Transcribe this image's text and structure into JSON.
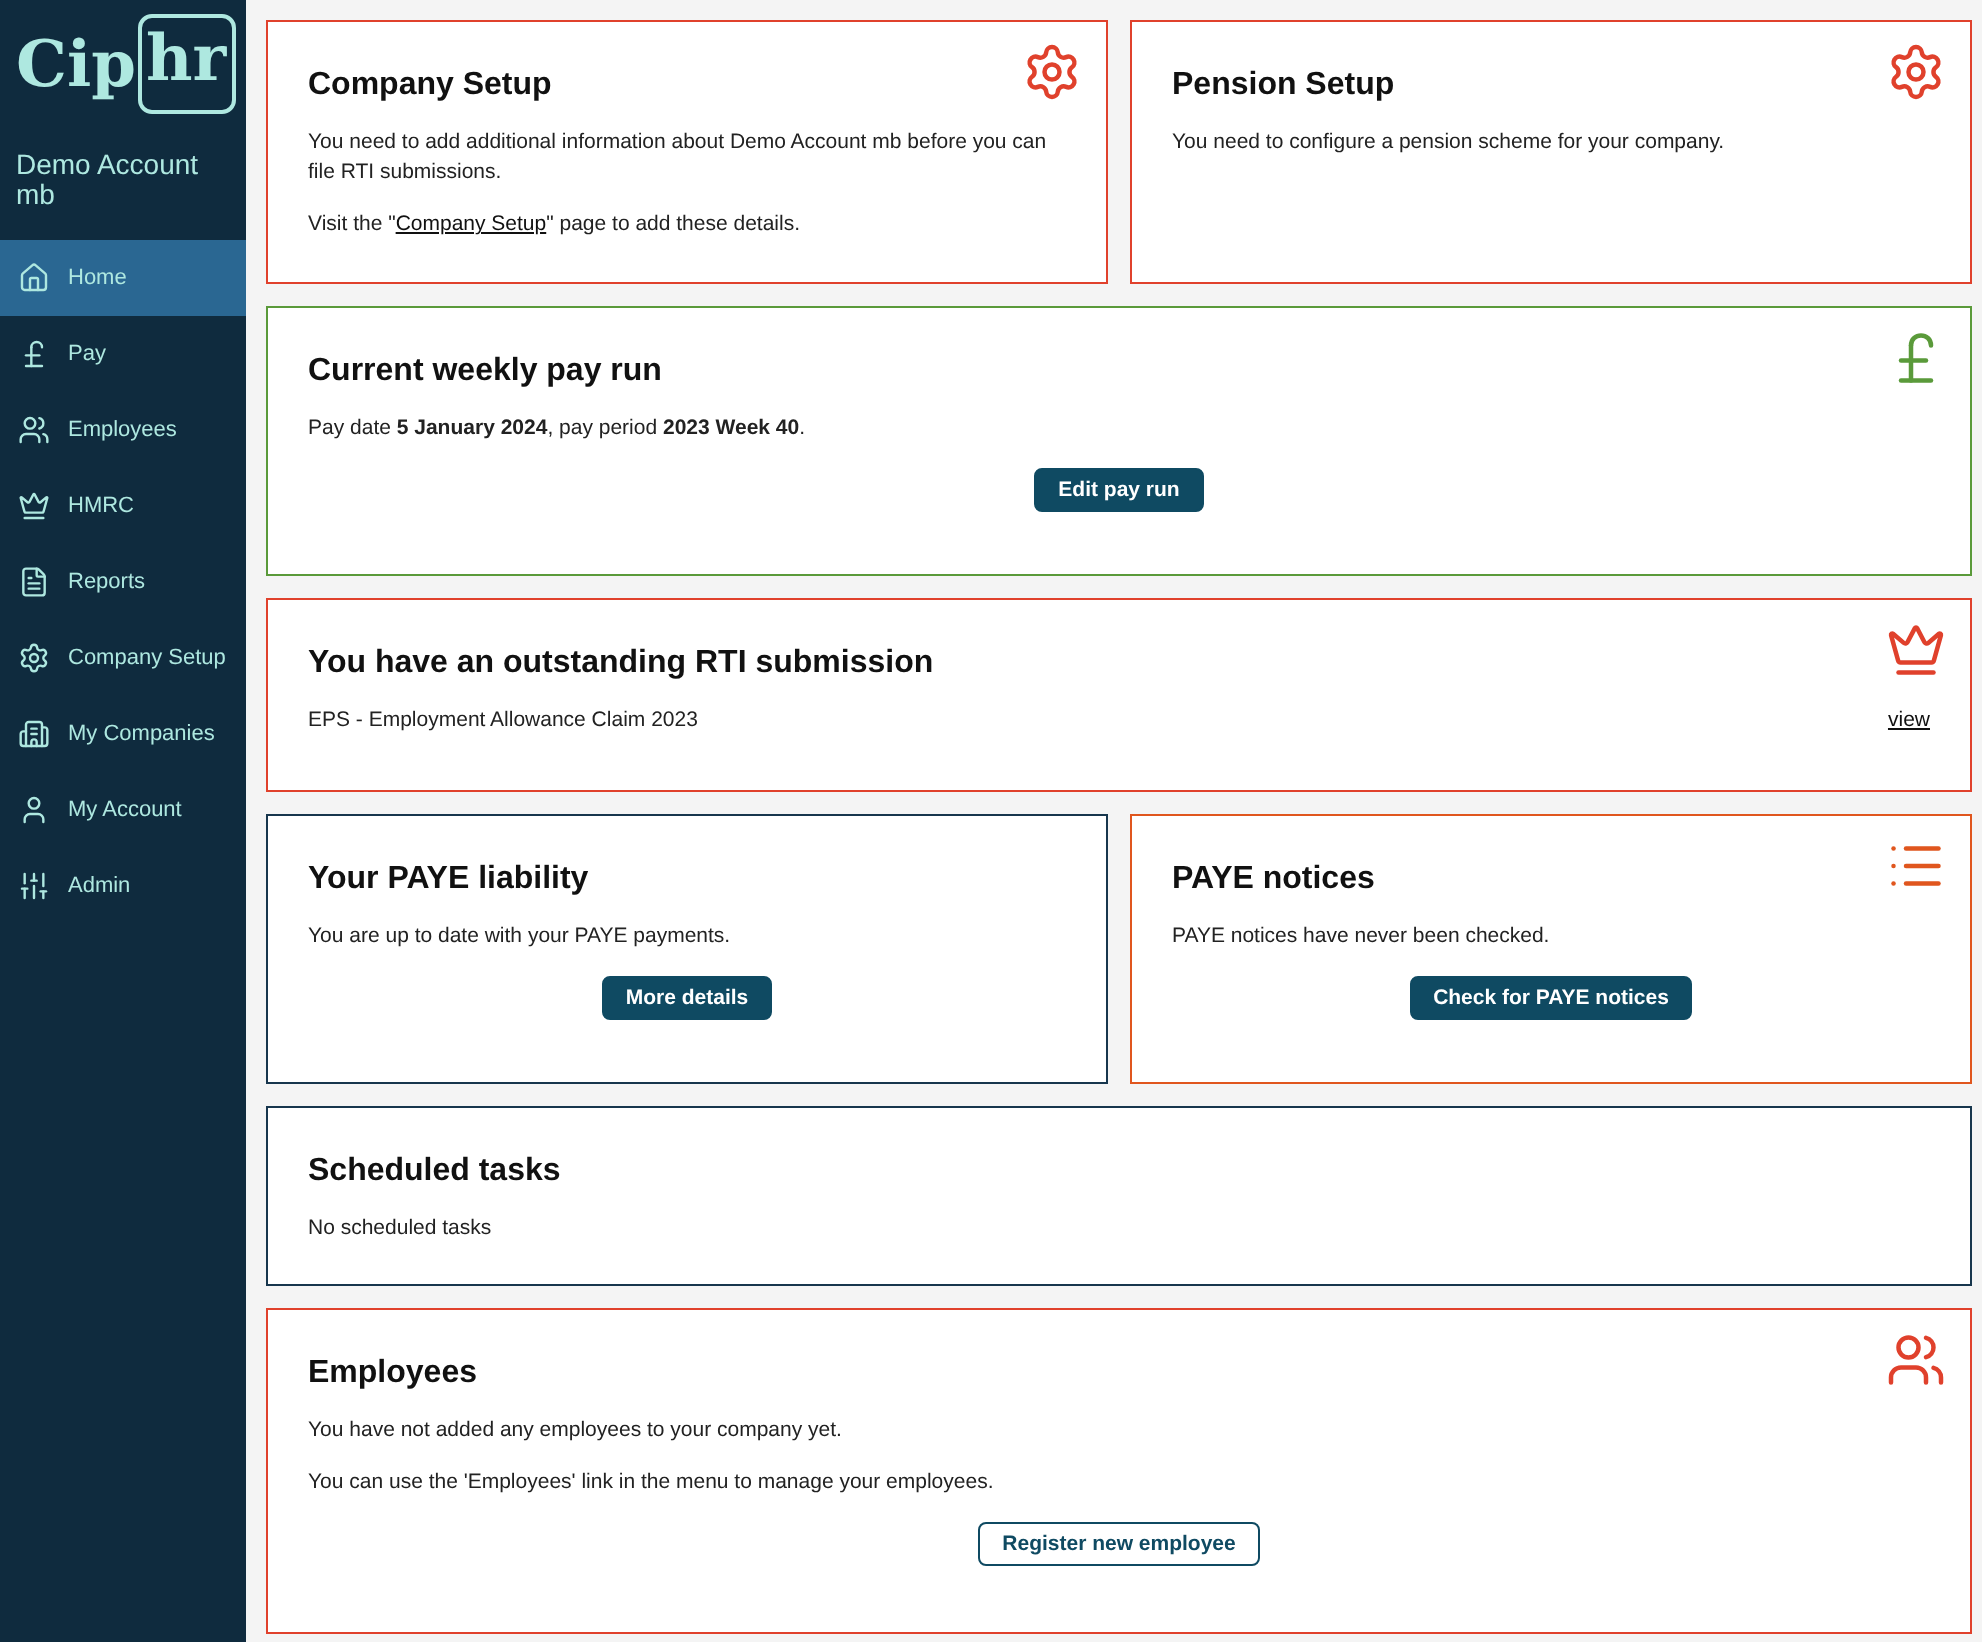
{
  "sidebar": {
    "logo": {
      "plain": "Cip",
      "boxed": "hr"
    },
    "account": "Demo Account mb",
    "items": [
      {
        "label": "Home",
        "selected": true
      },
      {
        "label": "Pay",
        "selected": false
      },
      {
        "label": "Employees",
        "selected": false
      },
      {
        "label": "HMRC",
        "selected": false
      },
      {
        "label": "Reports",
        "selected": false
      },
      {
        "label": "Company Setup",
        "selected": false
      },
      {
        "label": "My Companies",
        "selected": false
      },
      {
        "label": "My Account",
        "selected": false
      },
      {
        "label": "Admin",
        "selected": false
      }
    ]
  },
  "rows": [
    [
      {
        "title": "Company Setup",
        "kind": "setup",
        "color": "#e0412c",
        "paragraphs": [
          {
            "text": "You need to add additional information about Demo Account mb before you can file RTI submissions."
          },
          {
            "before": "Visit the \"",
            "link": "Company Setup",
            "after": "\" page to add these details."
          }
        ]
      },
      {
        "title": "Pension Setup",
        "kind": "setup",
        "color": "#e0412c",
        "paragraphs": [
          {
            "text": "You need to configure a pension scheme for your company."
          }
        ]
      }
    ],
    [
      {
        "title": "Current weekly pay run",
        "kind": "payrun",
        "color": "#5a9a3a",
        "paragraphs": [
          {
            "text": "Pay date **5 January 2024**, pay period **2023 Week 40**."
          }
        ],
        "button": {
          "label": "Edit pay run",
          "kind": "filled"
        }
      }
    ],
    [
      {
        "title": "You have an outstanding RTI submission",
        "kind": "submission",
        "color": "#e0412c",
        "paragraphs": [
          {
            "text": "EPS - Employment Allowance Claim 2023",
            "side_link": "view"
          }
        ]
      }
    ],
    [
      {
        "title": "Your PAYE liability",
        "kind": "plain",
        "color": "#17364d",
        "paragraphs": [
          {
            "text": "You are up to date with your PAYE payments."
          }
        ],
        "button": {
          "label": "More details",
          "kind": "filled"
        }
      },
      {
        "title": "PAYE notices",
        "kind": "notices",
        "color": "#e0561e",
        "paragraphs": [
          {
            "text": "PAYE notices have never been checked."
          }
        ],
        "button": {
          "label": "Check for PAYE notices",
          "kind": "filled"
        }
      }
    ],
    [
      {
        "title": "Scheduled tasks",
        "kind": "plain",
        "color": "#17364d",
        "paragraphs": [
          {
            "text": "No scheduled tasks"
          }
        ]
      }
    ],
    [
      {
        "title": "Employees",
        "kind": "staff",
        "color": "#e0412c",
        "paragraphs": [
          {
            "text": "You have not added any employees to your company yet."
          },
          {
            "text": "You can use the 'Employees' link in the menu to manage your employees."
          }
        ],
        "button": {
          "label": "Register new employee",
          "kind": "outline"
        }
      }
    ]
  ]
}
